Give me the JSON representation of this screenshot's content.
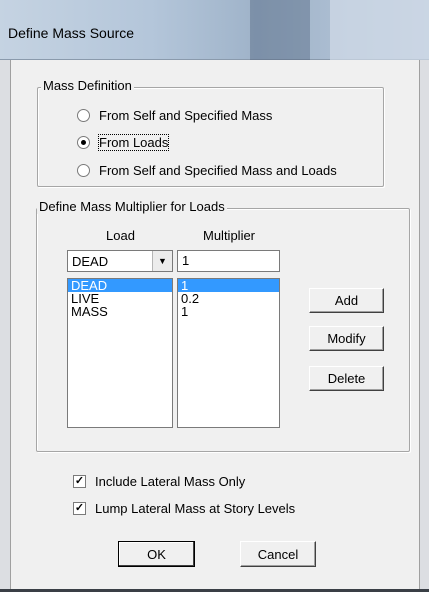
{
  "window": {
    "title": "Define Mass Source"
  },
  "mass_definition": {
    "legend": "Mass Definition",
    "options": [
      {
        "label": "From Self and Specified Mass",
        "checked": false
      },
      {
        "label": "From Loads",
        "checked": true
      },
      {
        "label": "From Self and Specified Mass and Loads",
        "checked": false
      }
    ]
  },
  "multiplier_group": {
    "legend": "Define Mass Multiplier for Loads",
    "load_header": "Load",
    "multiplier_header": "Multiplier",
    "load_combo_value": "DEAD",
    "multiplier_input_value": "1",
    "loads": [
      "DEAD",
      "LIVE",
      "MASS"
    ],
    "multipliers": [
      "1",
      "0.2",
      "1"
    ],
    "selected_index": 0,
    "add_label": "Add",
    "modify_label": "Modify",
    "delete_label": "Delete"
  },
  "options": {
    "include_lateral": {
      "label": "Include Lateral Mass Only",
      "checked": true
    },
    "lump_lateral": {
      "label": "Lump Lateral Mass at Story Levels",
      "checked": true
    }
  },
  "footer": {
    "ok_label": "OK",
    "cancel_label": "Cancel"
  },
  "icons": {
    "combo_arrow": "chevron-down-icon",
    "check": "checkmark-icon"
  }
}
